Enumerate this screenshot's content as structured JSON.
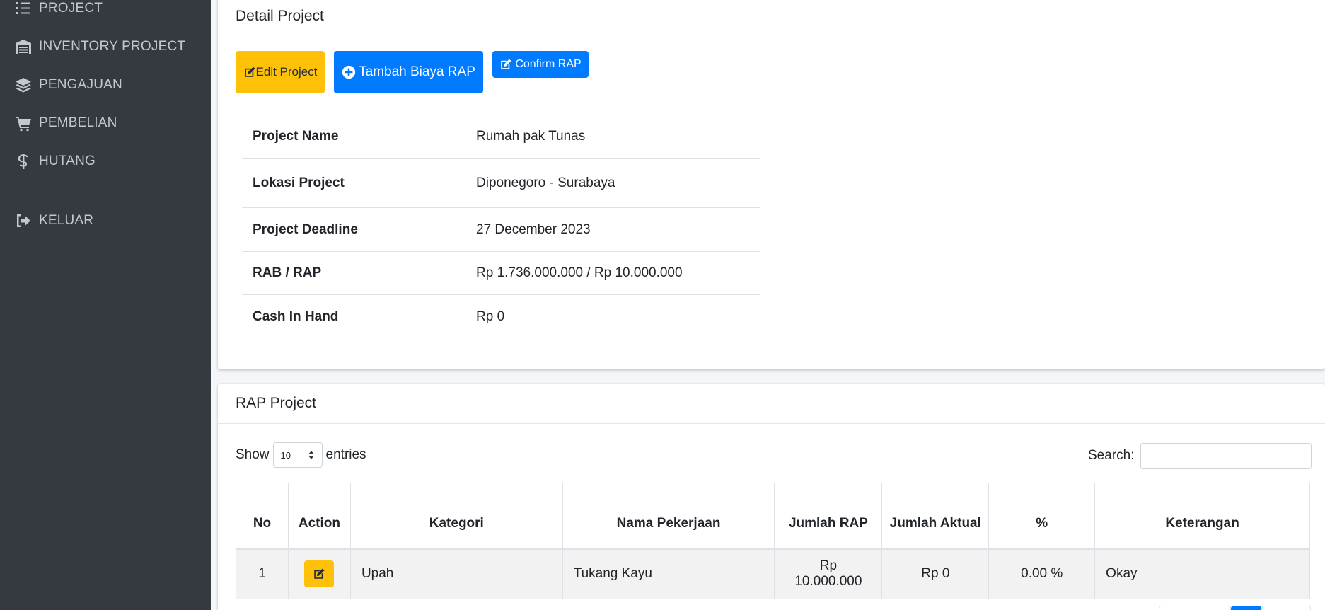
{
  "sidebar": {
    "items": [
      {
        "label": "PROJECT",
        "icon": "tasks-icon"
      },
      {
        "label": "INVENTORY PROJECT",
        "icon": "warehouse-icon"
      },
      {
        "label": "PENGAJUAN",
        "icon": "layers-icon"
      },
      {
        "label": "PEMBELIAN",
        "icon": "cart-icon"
      },
      {
        "label": "HUTANG",
        "icon": "dollar-icon"
      },
      {
        "label": "KELUAR",
        "icon": "sign-out-icon"
      }
    ]
  },
  "detail": {
    "title": "Detail Project",
    "buttons": {
      "edit": "Edit Project",
      "tambah": "Tambah Biaya RAP",
      "confirm": "Confirm RAP"
    },
    "rows": [
      {
        "key": "Project Name",
        "value": "Rumah pak Tunas"
      },
      {
        "key": "Lokasi Project",
        "value": "Diponegoro - Surabaya"
      },
      {
        "key": "Project Deadline",
        "value": "27 December 2023"
      },
      {
        "key": "RAB / RAP",
        "value": "Rp 1.736.000.000 / Rp 10.000.000"
      },
      {
        "key": "Cash In Hand",
        "value": "Rp 0"
      }
    ]
  },
  "rap": {
    "title": "RAP Project",
    "show_label": "Show",
    "entries_value": "10",
    "entries_label": "entries",
    "search_label": "Search:",
    "search_value": "",
    "columns": [
      "No",
      "Action",
      "Kategori",
      "Nama Pekerjaan",
      "Jumlah RAP",
      "Jumlah Aktual",
      "%",
      "Keterangan"
    ],
    "rows": [
      {
        "no": "1",
        "kategori": "Upah",
        "nama": "Tukang Kayu",
        "jumlah_rap": "Rp 10.000.000",
        "jumlah_aktual": "Rp 0",
        "persen": "0.00 %",
        "keterangan": "Okay"
      }
    ]
  },
  "colors": {
    "sidebar_bg": "#343a40",
    "warning": "#ffc107",
    "primary": "#007bff"
  }
}
